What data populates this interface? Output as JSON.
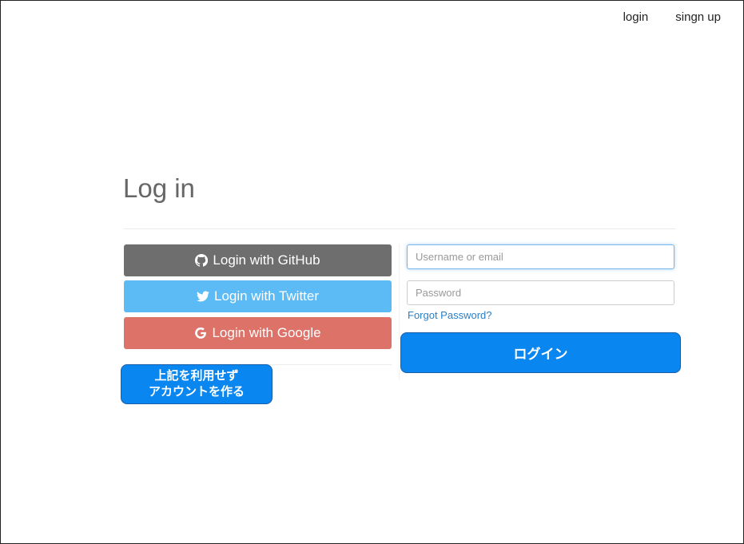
{
  "nav": {
    "login_label": "login",
    "signup_label": "singn up"
  },
  "page": {
    "title": "Log in"
  },
  "social": {
    "github_label": "Login with GitHub",
    "twitter_label": "Login with Twitter",
    "google_label": "Login with Google",
    "github_icon": "github-icon",
    "twitter_icon": "twitter-icon",
    "google_icon": "google-icon"
  },
  "create_account": {
    "line1": "上記を利用せず",
    "line2": "アカウントを作る"
  },
  "form": {
    "username_placeholder": "Username or email",
    "username_value": "",
    "password_placeholder": "Password",
    "password_value": "",
    "forgot_label": "Forgot Password?",
    "submit_label": "ログイン"
  },
  "colors": {
    "github": "#6e6e6e",
    "twitter": "#5cbaf5",
    "google": "#dc7268",
    "primary": "#0a86f0",
    "link": "#2a7fc4"
  }
}
